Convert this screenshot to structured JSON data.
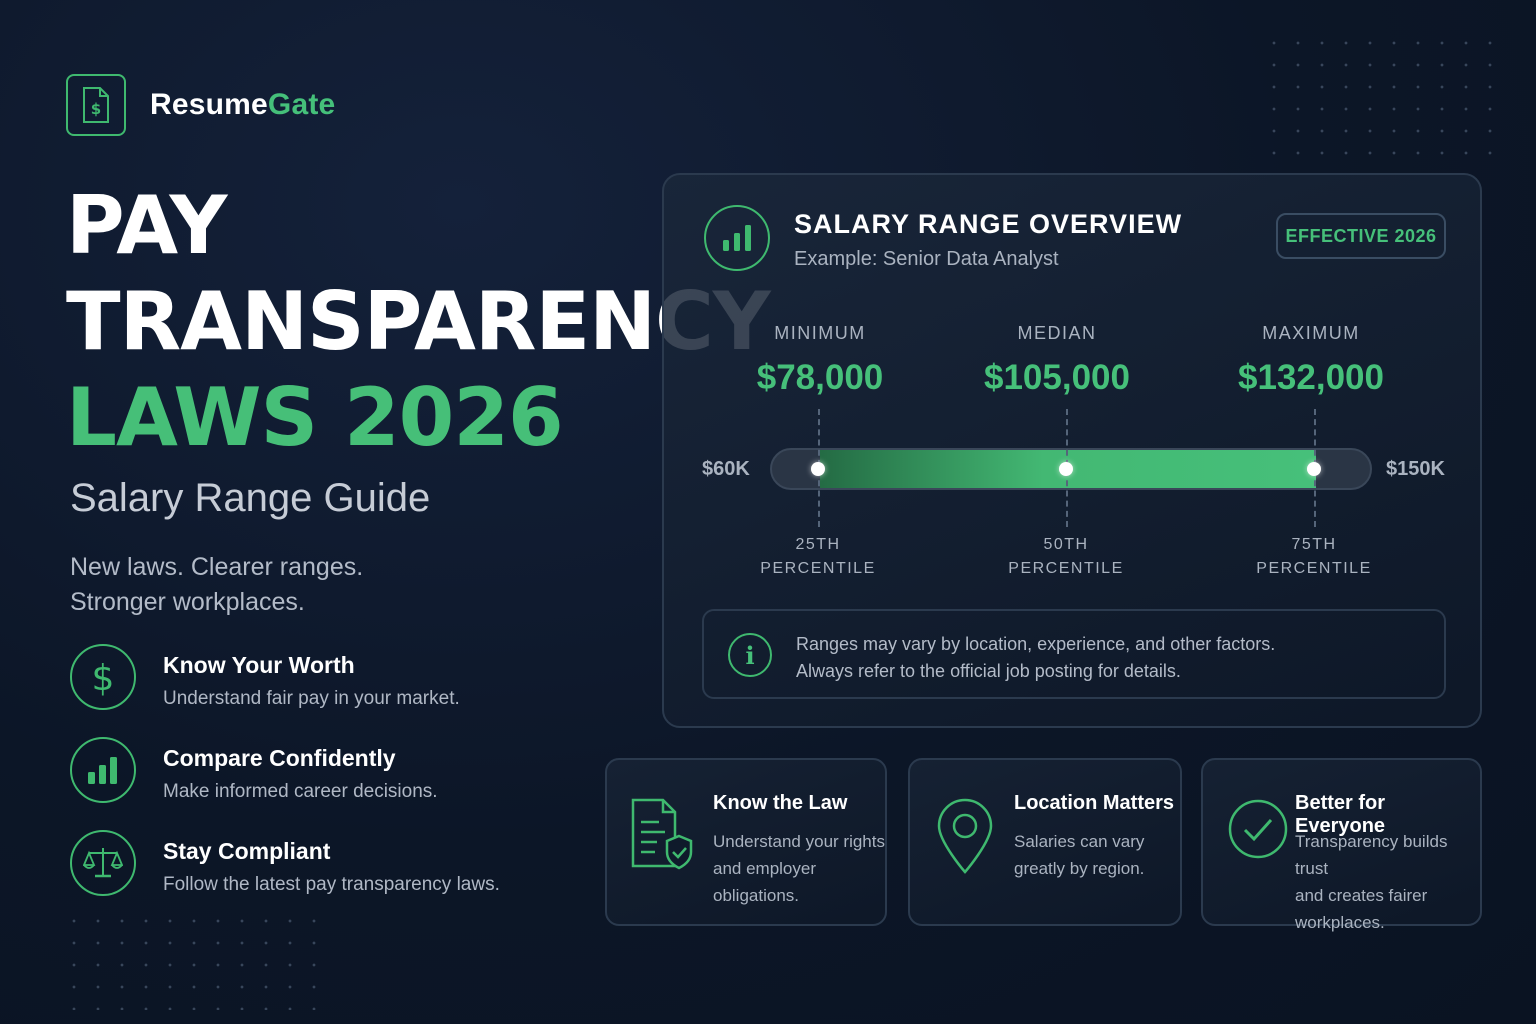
{
  "brand": {
    "name_part1": "Resume",
    "name_part2": "Gate",
    "icon": "dollar-document-icon"
  },
  "hero": {
    "line1": "PAY",
    "line2": "TRANSPARENCY",
    "line3": "LAWS 2026",
    "subtitle": "Salary Range Guide",
    "tagline_line1": "New laws. Clearer ranges.",
    "tagline_line2": "Stronger workplaces."
  },
  "features": [
    {
      "icon": "dollar-icon",
      "title": "Know Your Worth",
      "desc": "Understand fair pay in your market."
    },
    {
      "icon": "bar-chart-icon",
      "title": "Compare Confidently",
      "desc": "Make informed career decisions."
    },
    {
      "icon": "scales-icon",
      "title": "Stay Compliant",
      "desc": "Follow the latest pay transparency laws."
    }
  ],
  "salary_card": {
    "title": "SALARY RANGE OVERVIEW",
    "subtitle": "Example: Senior Data Analyst",
    "badge": "EFFECTIVE 2026",
    "stats": [
      {
        "label": "MINIMUM",
        "value": "$78,000"
      },
      {
        "label": "MEDIAN",
        "value": "$105,000"
      },
      {
        "label": "MAXIMUM",
        "value": "$132,000"
      }
    ],
    "range_min_label": "$60K",
    "range_max_label": "$150K",
    "range": {
      "min": 60000,
      "max": 150000,
      "points": [
        78000,
        105000,
        132000
      ]
    },
    "percentiles": [
      {
        "line1": "25TH",
        "line2": "PERCENTILE"
      },
      {
        "line1": "50TH",
        "line2": "PERCENTILE"
      },
      {
        "line1": "75TH",
        "line2": "PERCENTILE"
      }
    ],
    "info_line1": "Ranges may vary by location, experience, and other factors.",
    "info_line2": "Always refer to the official job posting for details."
  },
  "mini_cards": [
    {
      "icon": "document-shield-icon",
      "title": "Know the Law",
      "lines": [
        "Understand your rights",
        "and employer",
        "obligations."
      ]
    },
    {
      "icon": "location-pin-icon",
      "title": "Location Matters",
      "lines": [
        "Salaries can vary",
        "greatly by region."
      ]
    },
    {
      "icon": "check-circle-icon",
      "title": "Better for Everyone",
      "lines": [
        "Transparency builds trust",
        "and creates fairer",
        "workplaces."
      ]
    }
  ],
  "colors": {
    "accent": "#46c07a",
    "background": "#0c1627",
    "card_border": "#2b3a4e"
  }
}
